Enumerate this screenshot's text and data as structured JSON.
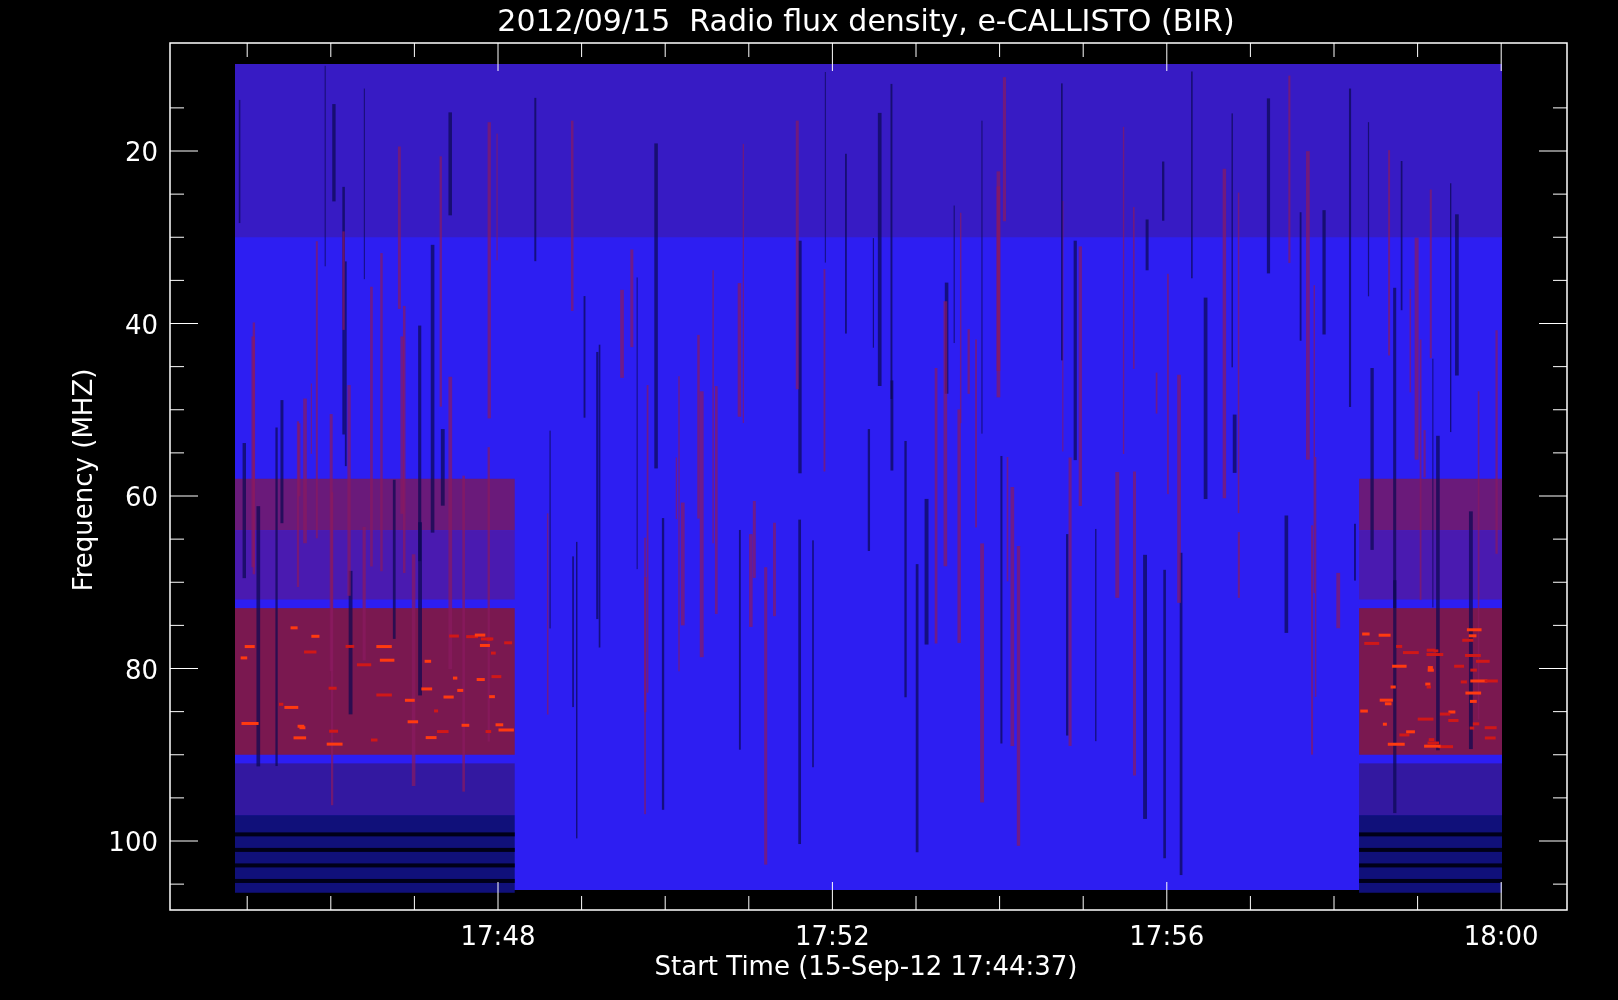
{
  "title": "2012/09/15  Radio flux density, e-CALLISTO (BIR)",
  "y_axis": {
    "label": "Frequency (MHZ)",
    "tick_labels": [
      "20",
      "40",
      "60",
      "80",
      "100"
    ]
  },
  "x_axis": {
    "label": "Start Time (15-Sep-12 17:44:37)",
    "tick_labels": [
      "17:48",
      "17:52",
      "17:56",
      "18:00"
    ]
  }
}
